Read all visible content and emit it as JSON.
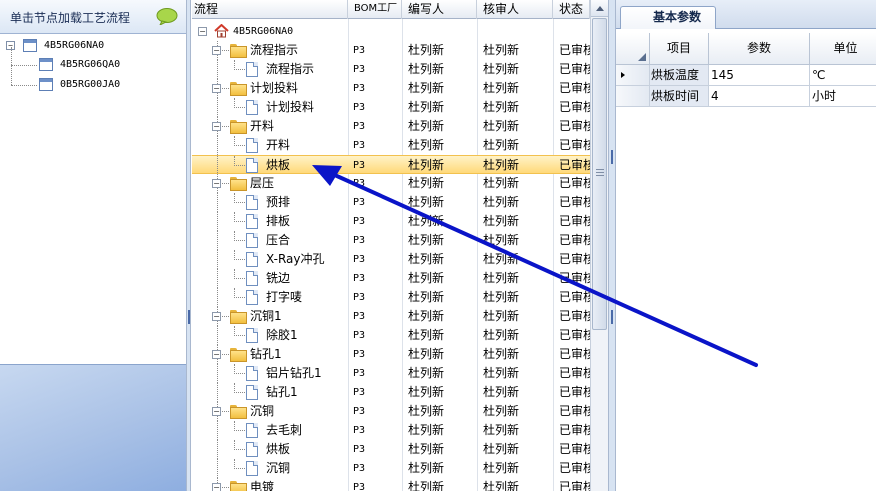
{
  "left_panel": {
    "title": "单击节点加载工艺流程",
    "tree": [
      {
        "label": "4B5RG06NA0",
        "level": 0
      },
      {
        "label": "4B5RG06QA0",
        "level": 1
      },
      {
        "label": "0B5RG00JA0",
        "level": 1
      }
    ]
  },
  "grid": {
    "columns": [
      "流程",
      "BOM工厂",
      "编写人",
      "核审人",
      "状态"
    ],
    "root_label": "4B5RG06NA0",
    "rows": [
      {
        "name": "流程指示",
        "type": "folder",
        "bom": "P3",
        "writer": "杜列新",
        "reviewer": "杜列新",
        "status": "已审核"
      },
      {
        "name": "流程指示",
        "type": "doc",
        "bom": "P3",
        "writer": "杜列新",
        "reviewer": "杜列新",
        "status": "已审核"
      },
      {
        "name": "计划投料",
        "type": "folder",
        "bom": "P3",
        "writer": "杜列新",
        "reviewer": "杜列新",
        "status": "已审核"
      },
      {
        "name": "计划投料",
        "type": "doc",
        "bom": "P3",
        "writer": "杜列新",
        "reviewer": "杜列新",
        "status": "已审核"
      },
      {
        "name": "开料",
        "type": "folder",
        "bom": "P3",
        "writer": "杜列新",
        "reviewer": "杜列新",
        "status": "已审核"
      },
      {
        "name": "开料",
        "type": "doc",
        "bom": "P3",
        "writer": "杜列新",
        "reviewer": "杜列新",
        "status": "已审核"
      },
      {
        "name": "烘板",
        "type": "doc",
        "bom": "P3",
        "writer": "杜列新",
        "reviewer": "杜列新",
        "status": "已审核",
        "selected": true
      },
      {
        "name": "层压",
        "type": "folder",
        "bom": "P3",
        "writer": "杜列新",
        "reviewer": "杜列新",
        "status": "已审核"
      },
      {
        "name": "预排",
        "type": "doc",
        "bom": "P3",
        "writer": "杜列新",
        "reviewer": "杜列新",
        "status": "已审核"
      },
      {
        "name": "排板",
        "type": "doc",
        "bom": "P3",
        "writer": "杜列新",
        "reviewer": "杜列新",
        "status": "已审核"
      },
      {
        "name": "压合",
        "type": "doc",
        "bom": "P3",
        "writer": "杜列新",
        "reviewer": "杜列新",
        "status": "已审核"
      },
      {
        "name": "X-Ray冲孔",
        "type": "doc",
        "bom": "P3",
        "writer": "杜列新",
        "reviewer": "杜列新",
        "status": "已审核"
      },
      {
        "name": "铣边",
        "type": "doc",
        "bom": "P3",
        "writer": "杜列新",
        "reviewer": "杜列新",
        "status": "已审核"
      },
      {
        "name": "打字唛",
        "type": "doc",
        "bom": "P3",
        "writer": "杜列新",
        "reviewer": "杜列新",
        "status": "已审核"
      },
      {
        "name": "沉铜1",
        "type": "folder",
        "bom": "P3",
        "writer": "杜列新",
        "reviewer": "杜列新",
        "status": "已审核"
      },
      {
        "name": "除胶1",
        "type": "doc",
        "bom": "P3",
        "writer": "杜列新",
        "reviewer": "杜列新",
        "status": "已审核"
      },
      {
        "name": "钻孔1",
        "type": "folder",
        "bom": "P3",
        "writer": "杜列新",
        "reviewer": "杜列新",
        "status": "已审核"
      },
      {
        "name": "铝片钻孔1",
        "type": "doc",
        "bom": "P3",
        "writer": "杜列新",
        "reviewer": "杜列新",
        "status": "已审核"
      },
      {
        "name": "钻孔1",
        "type": "doc",
        "bom": "P3",
        "writer": "杜列新",
        "reviewer": "杜列新",
        "status": "已审核"
      },
      {
        "name": "沉铜",
        "type": "folder",
        "bom": "P3",
        "writer": "杜列新",
        "reviewer": "杜列新",
        "status": "已审核"
      },
      {
        "name": "去毛刺",
        "type": "doc",
        "bom": "P3",
        "writer": "杜列新",
        "reviewer": "杜列新",
        "status": "已审核"
      },
      {
        "name": "烘板",
        "type": "doc",
        "bom": "P3",
        "writer": "杜列新",
        "reviewer": "杜列新",
        "status": "已审核"
      },
      {
        "name": "沉铜",
        "type": "doc",
        "bom": "P3",
        "writer": "杜列新",
        "reviewer": "杜列新",
        "status": "已审核"
      },
      {
        "name": "电镀",
        "type": "folder",
        "bom": "P3",
        "writer": "杜列新",
        "reviewer": "杜列新",
        "status": "已审核"
      }
    ]
  },
  "right_panel": {
    "tab_label": "基本参数",
    "columns": [
      "项目",
      "参数",
      "单位"
    ],
    "rows": [
      {
        "item": "烘板温度",
        "value": "145",
        "unit": "℃",
        "current": true
      },
      {
        "item": "烘板时间",
        "value": "4",
        "unit": "小时",
        "current": false
      }
    ]
  },
  "colors": {
    "selection": "#ffd97a",
    "arrow": "#0a14c8",
    "accent": "#8ea5c8"
  }
}
